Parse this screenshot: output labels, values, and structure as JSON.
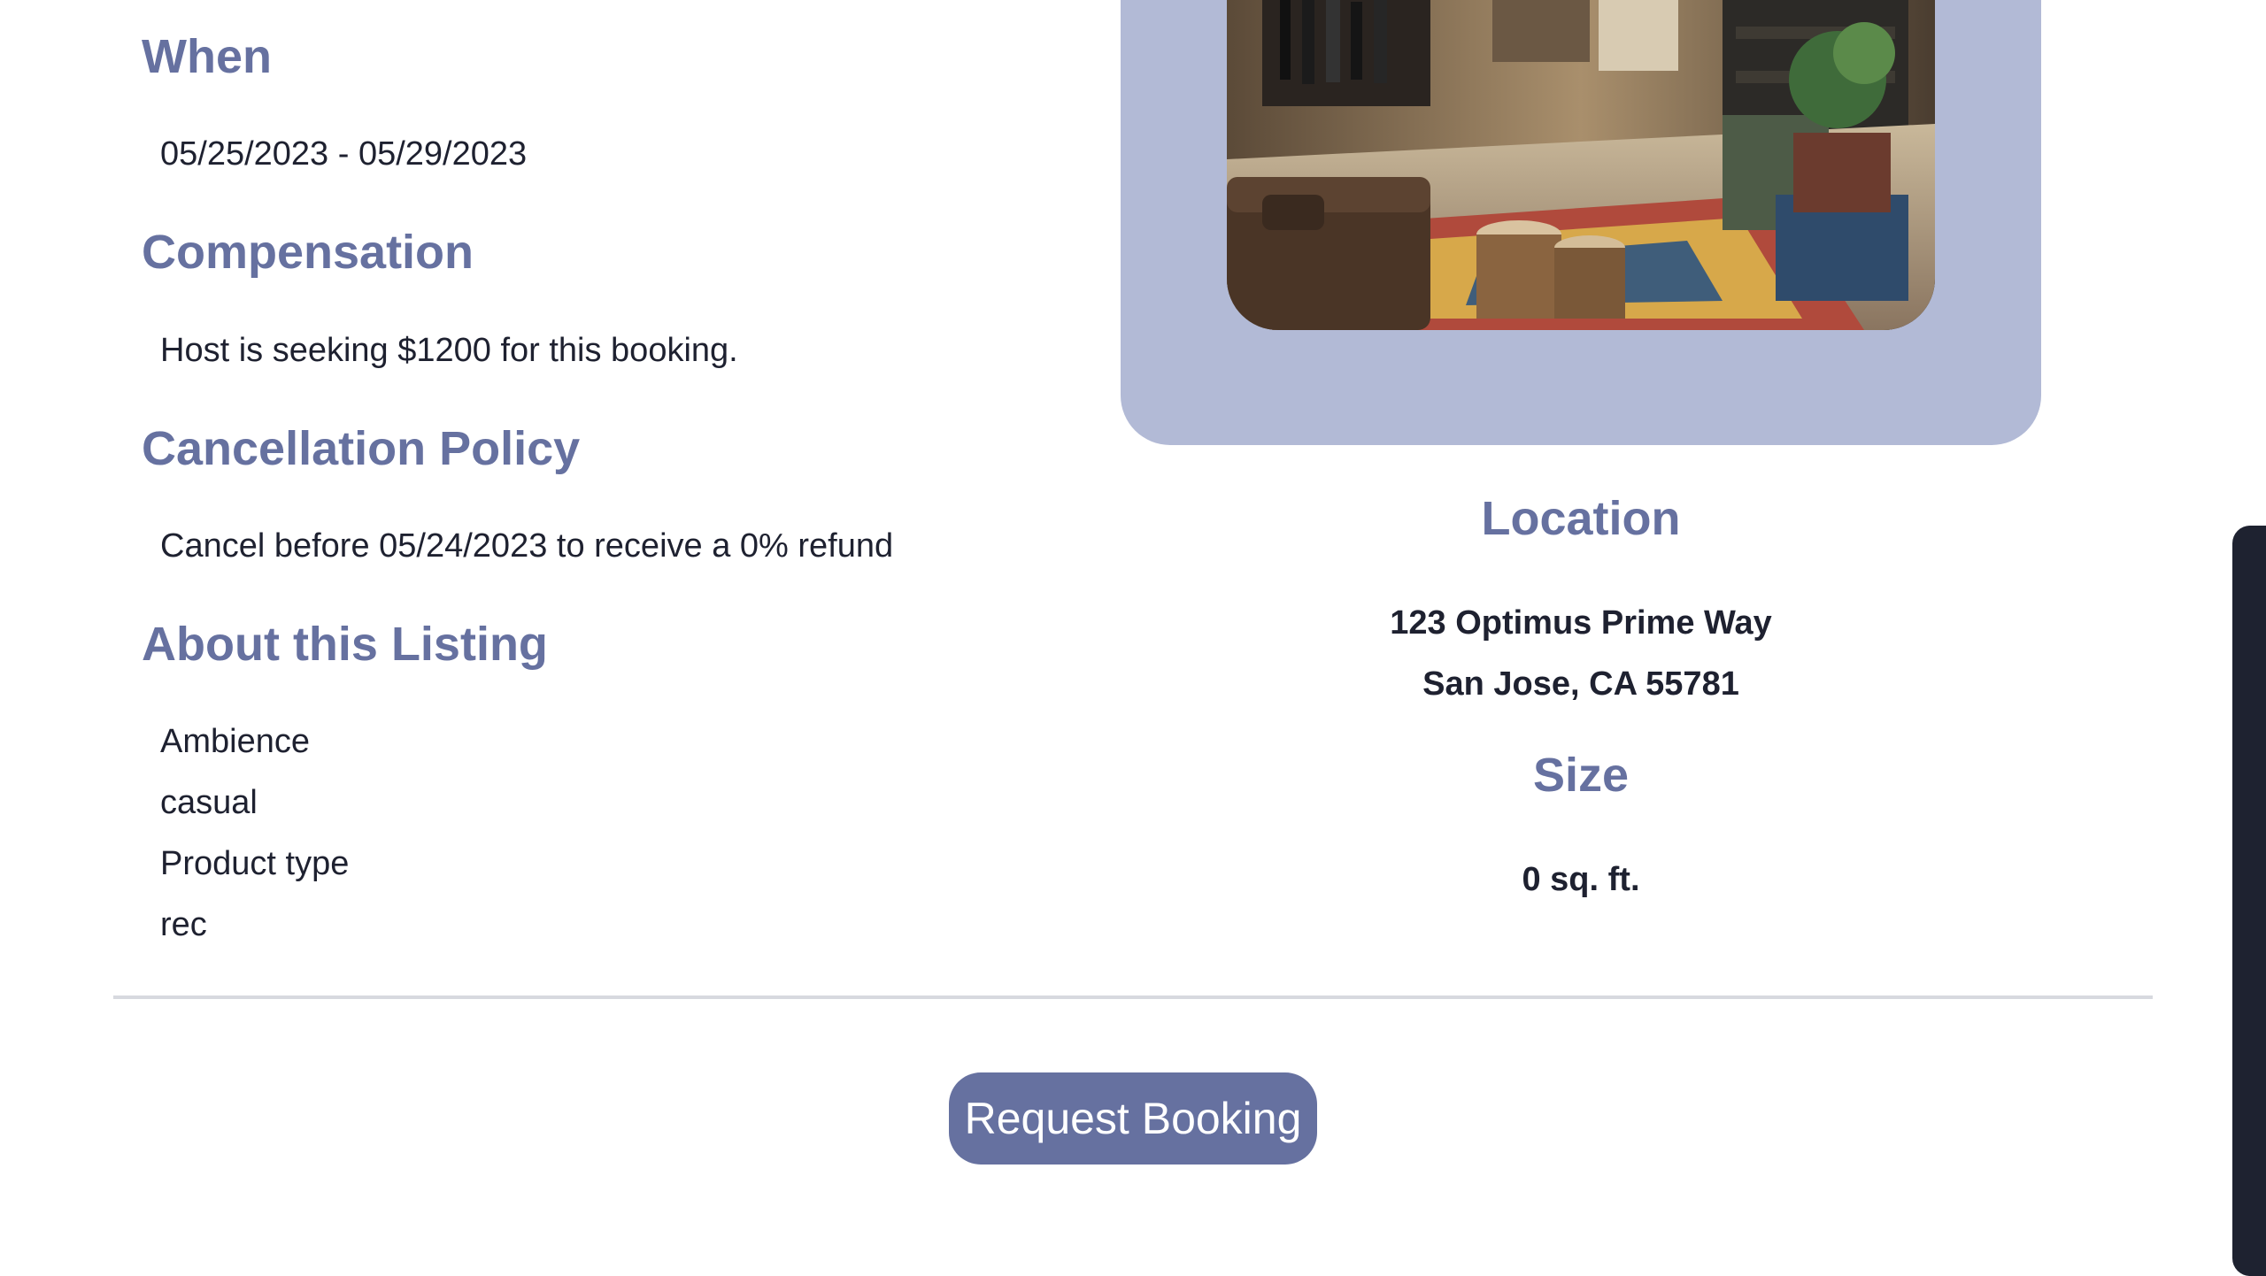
{
  "details": {
    "when": {
      "heading": "When",
      "text": "05/25/2023 - 05/29/2023"
    },
    "compensation": {
      "heading": "Compensation",
      "text": "Host is seeking $1200 for this booking."
    },
    "cancellation": {
      "heading": "Cancellation Policy",
      "text": "Cancel before 05/24/2023 to receive a 0% refund"
    },
    "about": {
      "heading": "About this Listing",
      "items": [
        "Ambience",
        "casual",
        "Product type",
        "rec"
      ]
    }
  },
  "location": {
    "heading": "Location",
    "address_line1": "123 Optimus Prime Way",
    "address_line2": "San Jose, CA 55781"
  },
  "size": {
    "heading": "Size",
    "value": "0 sq. ft."
  },
  "actions": {
    "request_label": "Request Booking"
  },
  "theme": {
    "accent": "#6671a0",
    "card_background": "#b2bad6",
    "text": "#1e2130",
    "divider": "#d7d9df",
    "scrollbar": "#1e2230"
  },
  "photo": {
    "subject": "store-interior-photo"
  }
}
